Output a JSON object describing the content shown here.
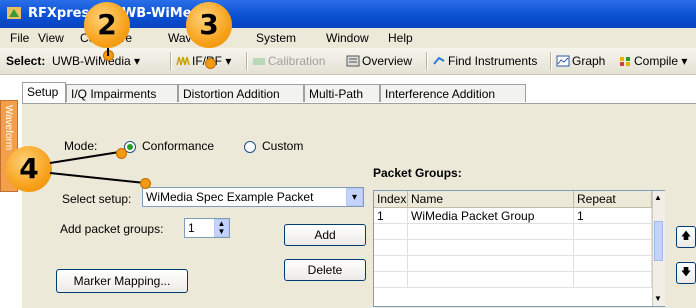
{
  "window": {
    "title": "RFXpress - UWB-WiMedia"
  },
  "menu": {
    "items": [
      "File",
      "View",
      "Configure",
      "Waveform",
      "System",
      "Window",
      "Help"
    ]
  },
  "toolbar": {
    "select_label": "Select:",
    "standard": "UWB-WiMedia",
    "ifrf": "IF/RF",
    "calibration": "Calibration",
    "overview": "Overview",
    "find_instruments": "Find Instruments",
    "graph": "Graph",
    "compile": "Compile"
  },
  "side_tab": "Waveform",
  "tabs": [
    "Setup",
    "I/Q Impairments",
    "Distortion Addition",
    "Multi-Path",
    "Interference Addition"
  ],
  "setup": {
    "mode_label": "Mode:",
    "mode_options": [
      "Conformance",
      "Custom"
    ],
    "select_setup_label": "Select setup:",
    "select_setup_value": "WiMedia Spec Example Packet",
    "add_groups_label": "Add packet groups:",
    "add_groups_value": "1",
    "add_button": "Add",
    "delete_button": "Delete",
    "marker_button": "Marker Mapping...",
    "packet_groups_title": "Packet Groups:",
    "table": {
      "headers": [
        "Index",
        "Name",
        "Repeat"
      ],
      "rows": [
        [
          "1",
          "WiMedia Packet Group",
          "1"
        ]
      ]
    }
  },
  "callouts": [
    "2",
    "3",
    "4"
  ],
  "colors": {
    "accent": "#f7a21b",
    "titlebar": "#0a4fd2"
  }
}
